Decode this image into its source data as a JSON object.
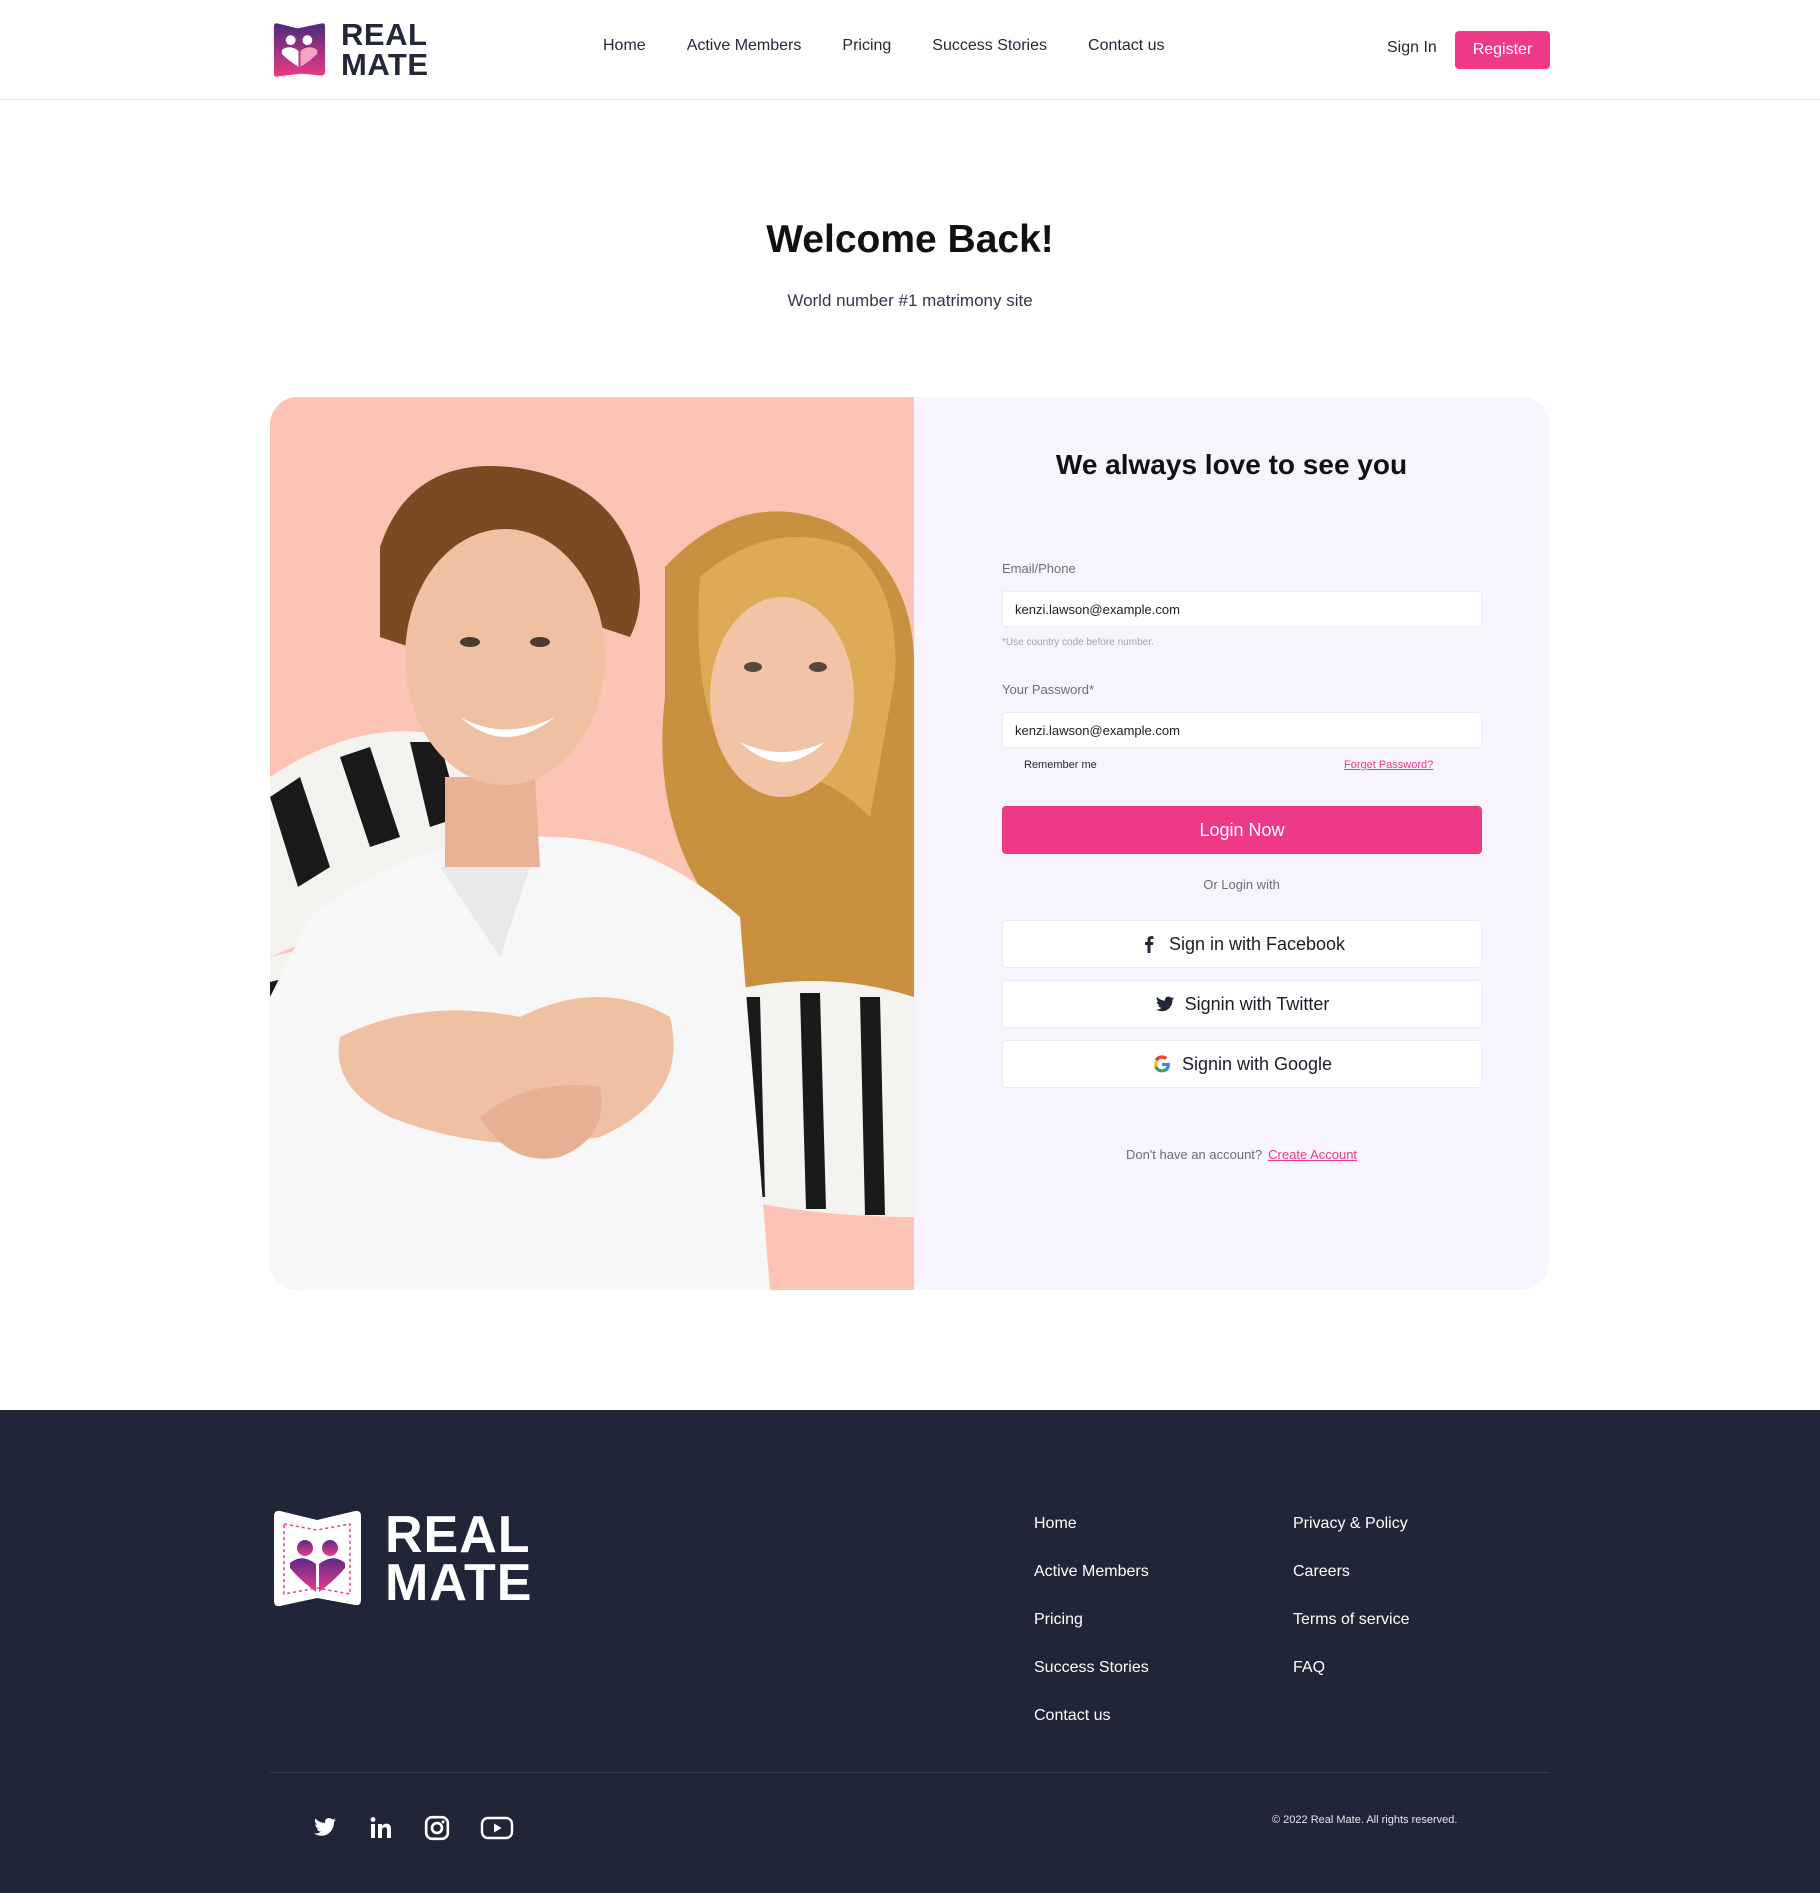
{
  "brand": {
    "line1": "REAL",
    "line2": "MATE",
    "pink": "#ee3a86",
    "navy": "#212538"
  },
  "nav": {
    "items": [
      "Home",
      "Active Members",
      "Pricing",
      "Success Stories",
      "Contact us"
    ],
    "signin": "Sign In",
    "register": "Register"
  },
  "hero": {
    "title": "Welcome Back!",
    "subtitle": "World number #1 matrimony site"
  },
  "form": {
    "title": "We always love to see you",
    "email_label": "Email/Phone",
    "email_value": "kenzi.lawson@example.com",
    "email_hint": "*Use country code before number.",
    "password_label": "Your Password*",
    "password_value": "kenzi.lawson@example.com",
    "remember": "Remember me",
    "forgot": "Forget Password?",
    "login": "Login Now",
    "or_text": "Or  Login with",
    "social": {
      "facebook": "Sign in with Facebook",
      "twitter": "Signin with Twitter",
      "google": "Signin with Google"
    },
    "no_account": "Don't have an account?",
    "create_account": "Create Account"
  },
  "footer": {
    "col1": [
      "Home",
      "Active Members",
      "Pricing",
      "Success Stories",
      "Contact us"
    ],
    "col2": [
      "Privacy & Policy",
      "Careers",
      "Terms of service",
      "FAQ"
    ],
    "social_icons": [
      "twitter-icon",
      "linkedin-icon",
      "instagram-icon",
      "youtube-icon"
    ],
    "copyright": "© 2022 Real Mate. All rights reserved."
  }
}
